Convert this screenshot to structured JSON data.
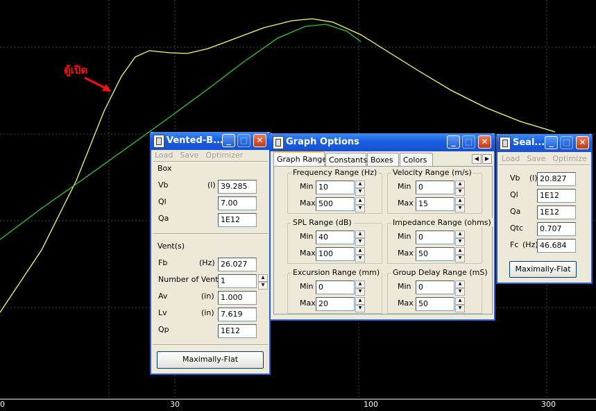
{
  "plot": {
    "background": "#000000",
    "grid_color": "#4a4a4a",
    "curve1_color": "#ffff66",
    "curve2_color": "#33cc33",
    "x_ticks": [
      "0",
      "30",
      "100",
      "300"
    ],
    "annotation_text": "ตู้เปิด",
    "annotation_color": "#ff1010"
  },
  "vented": {
    "title": "Vented-B...",
    "menu": [
      "Load",
      "Save",
      "Optimizer"
    ],
    "box_group": "Box",
    "vb_label": "Vb",
    "vb_unit": "(l)",
    "vb_value": "39.285",
    "ql_label": "Ql",
    "ql_value": "7.00",
    "qa_label": "Qa",
    "qa_value": "1E12",
    "vents_group": "Vent(s)",
    "fb_label": "Fb",
    "fb_unit": "(Hz)",
    "fb_value": "26.027",
    "nvents_label": "Number of Vents",
    "nvents_value": "1",
    "av_label": "Av",
    "av_unit": "(in)",
    "av_value": "1.000",
    "lv_label": "Lv",
    "lv_unit": "(in)",
    "lv_value": "7.619",
    "qp_label": "Qp",
    "qp_value": "1E12",
    "button": "Maximally-Flat"
  },
  "graph": {
    "title": "Graph Options",
    "tabs": [
      "Graph Range",
      "Constants",
      "Boxes",
      "Colors"
    ],
    "min_label": "Min",
    "max_label": "Max",
    "freq": {
      "title": "Frequency Range (Hz)",
      "min": "10",
      "max": "500"
    },
    "velocity": {
      "title": "Velocity Range (m/s)",
      "min": "0",
      "max": "15"
    },
    "spl": {
      "title": "SPL Range (dB)",
      "min": "40",
      "max": "100"
    },
    "impedance": {
      "title": "Impedance Range (ohms)",
      "min": "0",
      "max": "50"
    },
    "excursion": {
      "title": "Excursion Range (mm)",
      "min": "0",
      "max": "20"
    },
    "delay": {
      "title": "Group Delay Range (mS)",
      "min": "0",
      "max": "50"
    }
  },
  "sealed": {
    "title": "Seal...",
    "menu": [
      "Load",
      "Save",
      "Optimize"
    ],
    "vb_label": "Vb",
    "vb_unit": "(l)",
    "vb_value": "20.827",
    "ql_label": "Ql",
    "ql_value": "1E12",
    "qa_label": "Qa",
    "qa_value": "1E12",
    "qtc_label": "Qtc",
    "qtc_value": "0.707",
    "fc_label": "Fc",
    "fc_unit": "(Hz)",
    "fc_value": "46.684",
    "button": "Maximally-Flat"
  }
}
